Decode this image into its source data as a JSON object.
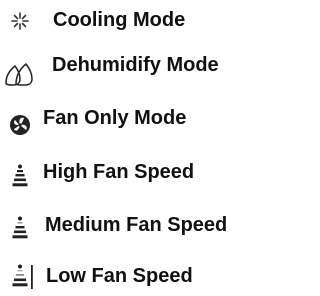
{
  "legend": {
    "items": [
      {
        "icon": "snowflake-icon",
        "label": "Cooling Mode"
      },
      {
        "icon": "droplets-icon",
        "label": "Dehumidify Mode"
      },
      {
        "icon": "fan-icon",
        "label": "Fan Only Mode"
      },
      {
        "icon": "fan-speed-high-icon",
        "label": "High Fan Speed"
      },
      {
        "icon": "fan-speed-medium-icon",
        "label": "Medium Fan Speed"
      },
      {
        "icon": "fan-speed-low-icon",
        "label": "Low Fan Speed"
      }
    ]
  },
  "colors": {
    "text": "#111111",
    "icon": "#222222",
    "background": "#ffffff"
  }
}
